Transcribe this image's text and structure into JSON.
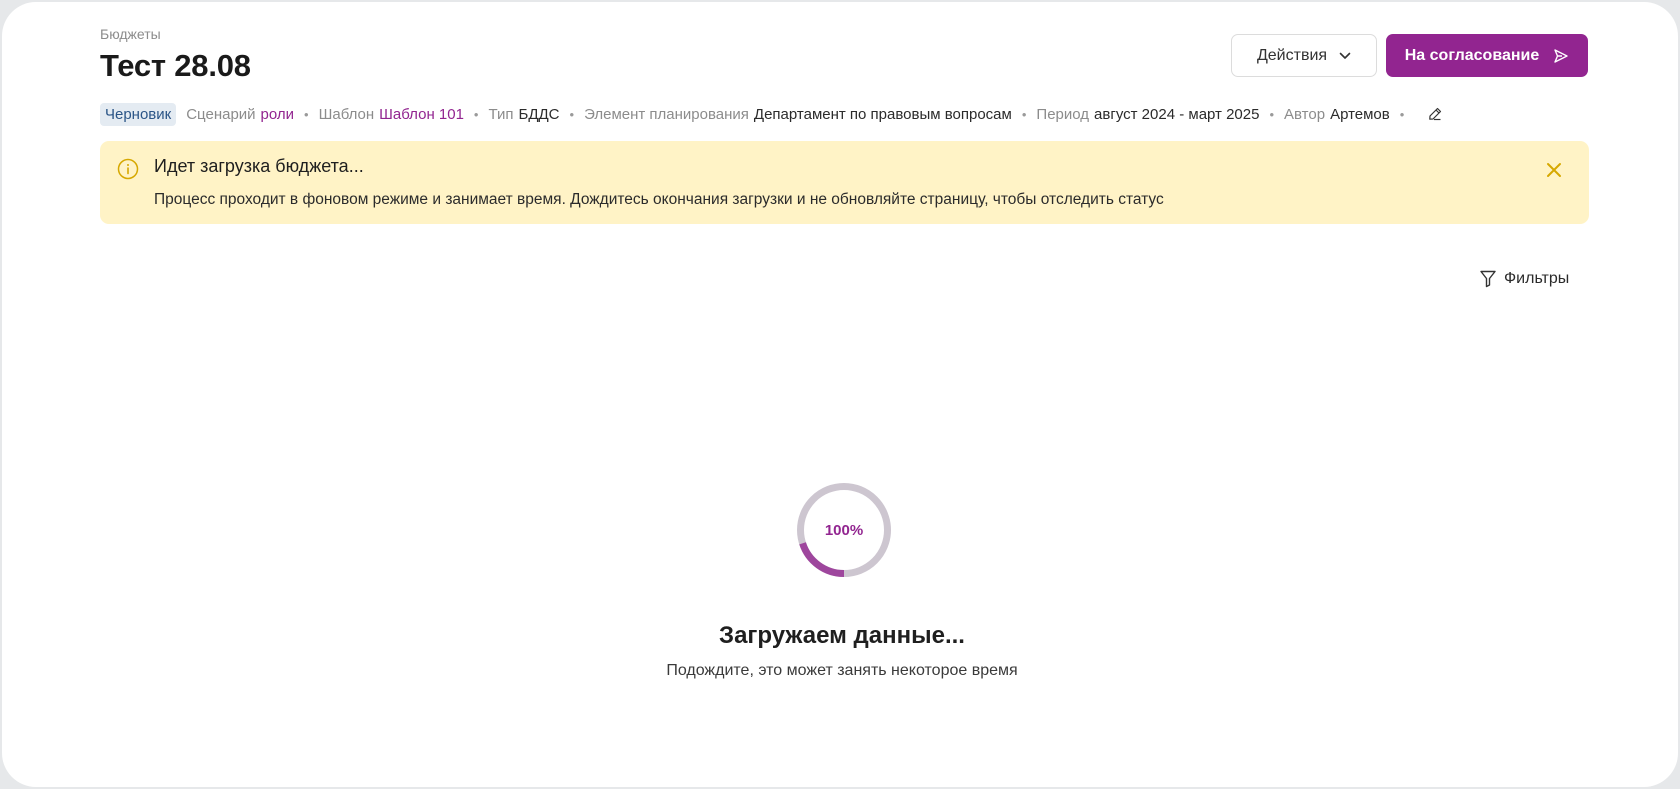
{
  "header": {
    "breadcrumb": "Бюджеты",
    "title": "Тест 28.08",
    "actions_label": "Действия",
    "submit_label": "На согласование"
  },
  "meta": {
    "status": "Черновик",
    "scenario_label": "Сценарий",
    "scenario_value": "роли",
    "template_label": "Шаблон",
    "template_value": "Шаблон 101",
    "type_label": "Тип",
    "type_value": "БДДС",
    "element_label": "Элемент планирования",
    "element_value": "Департамент по правовым вопросам",
    "period_label": "Период",
    "period_value": "август 2024 - март 2025",
    "author_label": "Автор",
    "author_value": "Артемов"
  },
  "alert": {
    "title": "Идет загрузка бюджета...",
    "text": "Процесс проходит в фоновом режиме и занимает время. Дождитесь окончания загрузки и не обновляйте страницу, чтобы отследить статус",
    "icon": "info-icon"
  },
  "toolbar": {
    "filters_label": "Фильтры"
  },
  "loading": {
    "percent_label": "100%",
    "arc_fill_fraction": 0.2,
    "title": "Загружаем данные...",
    "subtitle": "Подождите, это может занять некоторое время"
  },
  "colors": {
    "accent": "#922590",
    "alert_bg": "#fff3c6",
    "alert_icon": "#d6a800",
    "badge_bg": "#e4ebf2",
    "badge_text": "#2b5587",
    "ring_track": "#cdc6d0"
  }
}
